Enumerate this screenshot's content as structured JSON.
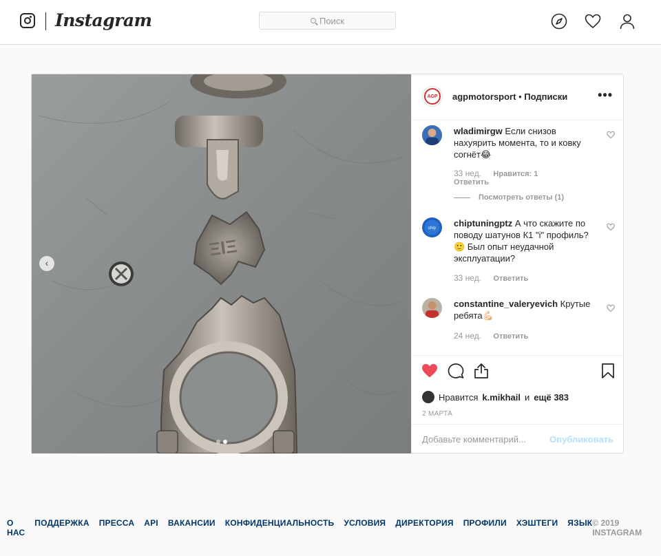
{
  "header": {
    "wordmark": "Instagram",
    "search_placeholder": "Поиск",
    "icons": [
      "instagram-logo-icon",
      "explore-compass-icon",
      "activity-heart-icon",
      "profile-icon"
    ]
  },
  "post": {
    "username": "agpmotorsport",
    "separator": "•",
    "follow_label": "Подписки",
    "brand_avatar_text": "AGP",
    "more_options": "•••",
    "carousel": {
      "total": 2,
      "current": 2
    },
    "comments": [
      {
        "user": "wladimirgw",
        "text": "Если снизов нахуярить момента, то и ковку согнёт😂",
        "age": "33 нед.",
        "likes": "Нравится: 1",
        "reply": "Ответить",
        "view_replies": "Посмотреть ответы (1)"
      },
      {
        "user": "chiptuningptz",
        "text": "А что скажите по поводу шатунов К1 \"i\" профиль? 🙂 Был опыт неудачной эксплуатации?",
        "age": "33 нед.",
        "reply": "Ответить"
      },
      {
        "user": "constantine_valeryevich",
        "text": "Крутые ребята💪🏻",
        "age": "24 нед.",
        "reply": "Ответить"
      }
    ],
    "likes": {
      "prefix": "Нравится",
      "user": "k.mikhail",
      "connector": "и",
      "others": "ещё 383"
    },
    "date": "2 МАРТА",
    "add_comment_placeholder": "Добавьте комментарий...",
    "publish_label": "Опубликовать",
    "colors": {
      "like_red": "#ed4956",
      "link_blue": "#003569",
      "publish_disabled": "#b2dffc"
    }
  },
  "footer": {
    "links": [
      "О НАС",
      "ПОДДЕРЖКА",
      "ПРЕССА",
      "API",
      "ВАКАНСИИ",
      "КОНФИДЕНЦИАЛЬНОСТЬ",
      "УСЛОВИЯ",
      "ДИРЕКТОРИЯ",
      "ПРОФИЛИ",
      "ХЭШТЕГИ",
      "ЯЗЫК"
    ],
    "copyright": "© 2019 INSTAGRAM"
  }
}
